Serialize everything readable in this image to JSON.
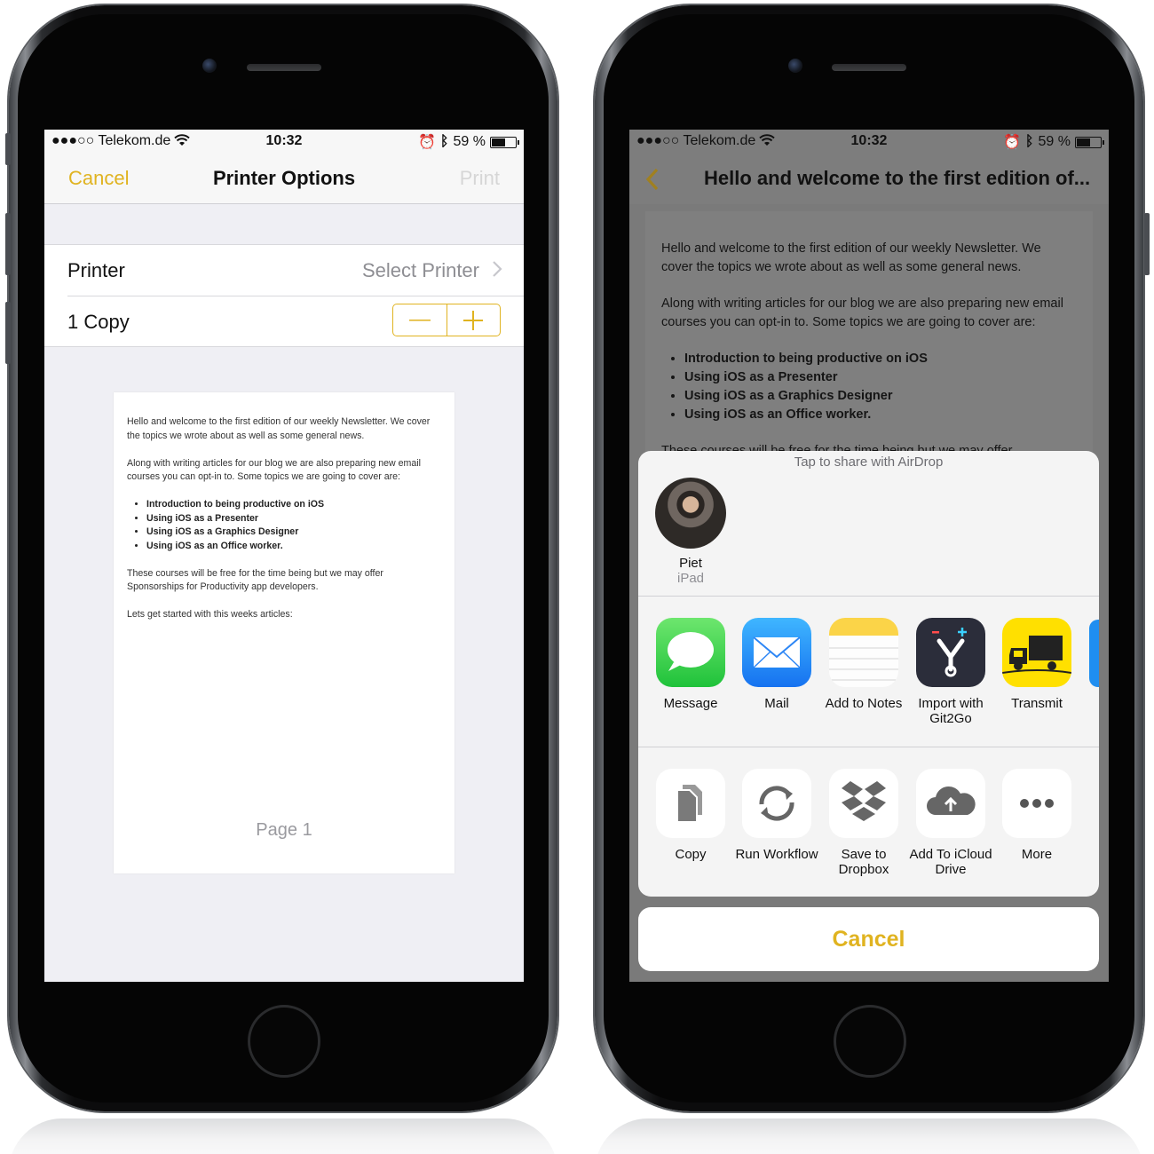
{
  "left_phone": {
    "status_bar": {
      "carrier": "●●●○○ Telekom.de",
      "time": "10:32",
      "battery": "59 %",
      "battery_level": 0.59
    },
    "nav": {
      "cancel": "Cancel",
      "title": "Printer Options",
      "print": "Print"
    },
    "printer_row": {
      "label": "Printer",
      "value": "Select Printer"
    },
    "copies_row": {
      "label": "1 Copy",
      "minus": "—",
      "plus": "+"
    },
    "preview": {
      "p1": "Hello and welcome to the first edition of our weekly Newsletter. We cover the topics we wrote about as well as some general news.",
      "p2": "Along with writing articles for our blog we are also preparing new email courses you can opt-in to. Some topics we are going to cover are:",
      "bullets": [
        "Introduction to being productive on iOS",
        "Using iOS as a Presenter",
        "Using iOS as a Graphics Designer",
        "Using iOS as an Office worker."
      ],
      "p3": "These courses will be free for the time being but we may offer Sponsorships for Productivity app developers.",
      "p4": "Lets get started with this weeks articles:",
      "page_label": "Page 1"
    }
  },
  "right_phone": {
    "status_bar": {
      "carrier": "●●●○○ Telekom.de",
      "time": "10:32",
      "battery": "59 %",
      "battery_level": 0.59
    },
    "nav": {
      "title": "Hello and welcome to the first edition of..."
    },
    "document": {
      "p1": "Hello and welcome to the first edition of our weekly Newsletter. We cover the topics we wrote about as well as some general news.",
      "p2": "Along with writing articles for our blog we are also preparing new email courses you can opt-in to. Some topics we are going to cover are:",
      "bullets": [
        "Introduction to being productive on iOS",
        "Using iOS as a Presenter",
        "Using iOS as a Graphics Designer",
        "Using iOS as an Office worker."
      ],
      "p3": "These courses will be free for the time being but we may offer"
    },
    "share_sheet": {
      "airdrop_hint": "Tap to share with AirDrop",
      "airdrop_person": {
        "name": "Piet",
        "device": "iPad"
      },
      "apps": [
        {
          "label": "Message",
          "icon": "message-icon"
        },
        {
          "label": "Mail",
          "icon": "mail-icon"
        },
        {
          "label": "Add to Notes",
          "icon": "notes-icon"
        },
        {
          "label": "Import with Git2Go",
          "icon": "git2go-icon"
        },
        {
          "label": "Transmit",
          "icon": "transmit-icon"
        }
      ],
      "actions": [
        {
          "label": "Copy",
          "icon": "copy-icon"
        },
        {
          "label": "Run Workflow",
          "icon": "workflow-icon"
        },
        {
          "label": "Save to Dropbox",
          "icon": "dropbox-icon"
        },
        {
          "label": "Add To iCloud Drive",
          "icon": "icloud-drive-icon"
        },
        {
          "label": "More",
          "icon": "more-icon"
        }
      ],
      "cancel": "Cancel"
    }
  },
  "colors": {
    "accent": "#e0b320",
    "disabled": "#d6d6d6",
    "secondary_text": "#8e8e93"
  }
}
